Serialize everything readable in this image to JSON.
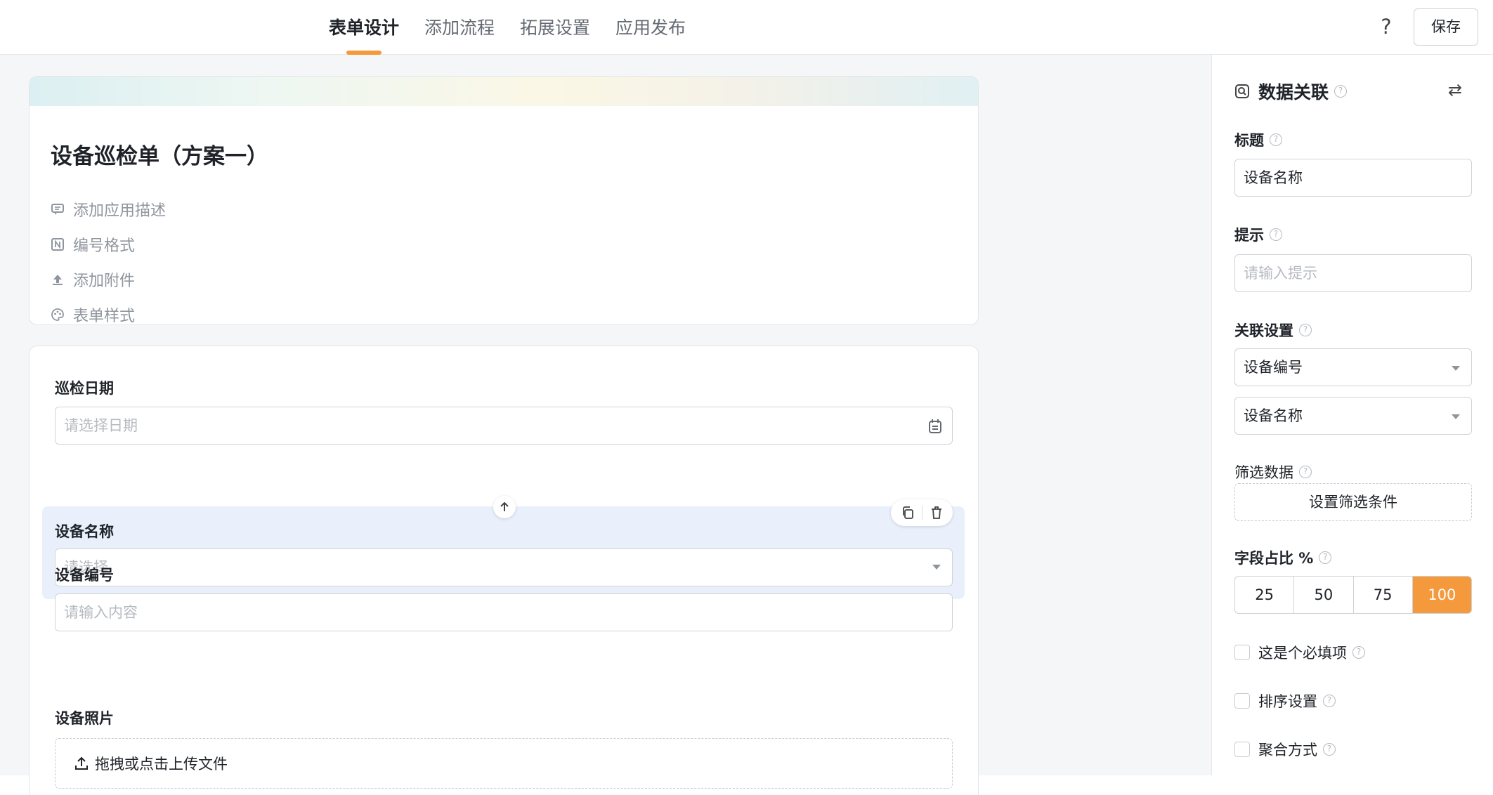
{
  "header": {
    "tabs": [
      {
        "label": "表单设计",
        "active": true
      },
      {
        "label": "添加流程",
        "active": false
      },
      {
        "label": "拓展设置",
        "active": false
      },
      {
        "label": "应用发布",
        "active": false
      }
    ],
    "help_icon": "question-icon",
    "save_label": "保存",
    "accent_color": "#f59a3c"
  },
  "form": {
    "title": "设备巡检单（方案一）",
    "meta": [
      {
        "label": "添加应用描述",
        "icon": "comment-icon"
      },
      {
        "label": "编号格式",
        "icon": "numbering-icon"
      },
      {
        "label": "添加附件",
        "icon": "upload-icon"
      },
      {
        "label": "表单样式",
        "icon": "palette-icon"
      }
    ],
    "fields": [
      {
        "label": "巡检日期",
        "placeholder": "请选择日期",
        "icon": "calendar-icon"
      },
      {
        "label": "设备名称",
        "placeholder": "请选择",
        "selected": true
      },
      {
        "label": "设备编号",
        "placeholder": "请输入内容"
      },
      {
        "label": "设备照片",
        "upload_text": "拖拽或点击上传文件",
        "icon": "upload-icon"
      }
    ]
  },
  "panel": {
    "title": "数据关联",
    "title_icon": "search-doc-icon",
    "swap_icon": "swap-icon",
    "title_label": "标题",
    "title_value": "设备名称",
    "hint_label": "提示",
    "hint_placeholder": "请输入提示",
    "relation_label": "关联设置",
    "relation_values": [
      "设备编号",
      "设备名称"
    ],
    "filter_label": "筛选数据",
    "filter_button": "设置筛选条件",
    "width_label": "字段占比 %",
    "width_options": [
      "25",
      "50",
      "75",
      "100"
    ],
    "width_selected": "100",
    "checks": [
      {
        "label": "这是个必填项",
        "checked": false
      },
      {
        "label": "排序设置",
        "checked": false
      },
      {
        "label": "聚合方式",
        "checked": false
      }
    ]
  }
}
